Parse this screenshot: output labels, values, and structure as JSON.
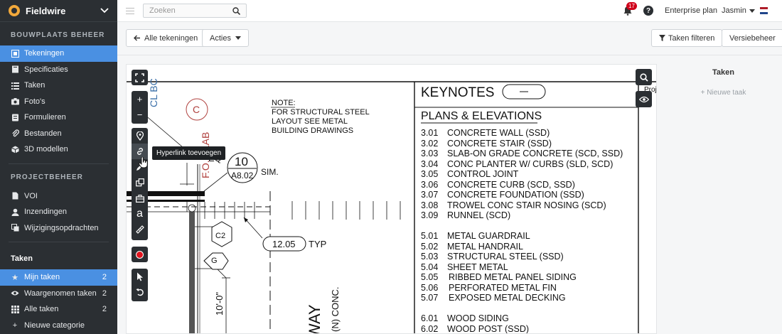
{
  "app": {
    "name": "Fieldwire"
  },
  "sidebar": {
    "section_site": "BOUWPLAATS BEHEER",
    "site_items": [
      {
        "label": "Tekeningen",
        "icon": "drawing-icon"
      },
      {
        "label": "Specificaties",
        "icon": "book-icon"
      },
      {
        "label": "Taken",
        "icon": "list-icon"
      },
      {
        "label": "Foto's",
        "icon": "camera-icon"
      },
      {
        "label": "Formulieren",
        "icon": "form-icon"
      },
      {
        "label": "Bestanden",
        "icon": "paperclip-icon"
      },
      {
        "label": "3D modellen",
        "icon": "cube-icon"
      }
    ],
    "section_project": "PROJECTBEHEER",
    "project_items": [
      {
        "label": "VOI",
        "icon": "document-icon"
      },
      {
        "label": "Inzendingen",
        "icon": "user-icon"
      },
      {
        "label": "Wijzigingsopdrachten",
        "icon": "change-order-icon"
      }
    ],
    "section_tasks": "Taken",
    "task_items": [
      {
        "label": "Mijn taken",
        "count": "2",
        "icon": "star-icon"
      },
      {
        "label": "Waargenomen taken",
        "count": "2",
        "icon": "eye-icon"
      },
      {
        "label": "Alle taken",
        "count": "2",
        "icon": "grid-icon"
      },
      {
        "label": "Nieuwe categorie",
        "count": "",
        "icon": "plus-icon"
      }
    ]
  },
  "topbar": {
    "search_placeholder": "Zoeken",
    "notification_count": "17",
    "plan": "Enterprise plan",
    "user": "Jasmin"
  },
  "toolbar": {
    "all_drawings": "Alle tekeningen",
    "actions": "Acties",
    "filter_tasks": "Taken filteren",
    "version_management": "Versiebeheer"
  },
  "drawing": {
    "tooltip": "Hyperlink toevoegen",
    "note_lines": [
      "NOTE:",
      "FOR STRUCTURAL STEEL",
      "LAYOUT SEE METAL",
      "BUILDING DRAWINGS"
    ],
    "keynotes_title": "KEYNOTES",
    "plans_title": "PLANS & ELEVATIONS",
    "keynotes": [
      {
        "code": "3.01",
        "text": "CONCRETE WALL (SSD)"
      },
      {
        "code": "3.02",
        "text": "CONCRETE STAIR (SSD)"
      },
      {
        "code": "3.03",
        "text": "SLAB-ON GRADE CONCRETE (SCD, SSD)"
      },
      {
        "code": "3.04",
        "text": "CONC PLANTER W/ CURBS (SLD, SCD)"
      },
      {
        "code": "3.05",
        "text": "CONTROL JOINT"
      },
      {
        "code": "3.06",
        "text": "CONCRETE CURB (SCD, SSD)"
      },
      {
        "code": "3.07",
        "text": "CONCRETE FOUNDATION (SSD)"
      },
      {
        "code": "3.08",
        "text": "TROWEL CONC STAIR NOSING (SCD)"
      },
      {
        "code": "3.09",
        "text": "RUNNEL (SCD)"
      },
      {
        "code": "5.01",
        "text": "METAL GUARDRAIL"
      },
      {
        "code": "5.02",
        "text": "METAL HANDRAIL"
      },
      {
        "code": "5.03",
        "text": "STRUCTURAL STEEL (SSD)"
      },
      {
        "code": "5.04",
        "text": "SHEET METAL"
      },
      {
        "code": "5.05",
        "text": "RIBBED METAL PANEL SIDING"
      },
      {
        "code": "5.06",
        "text": "PERFORATED METAL FIN"
      },
      {
        "code": "5.07",
        "text": "EXPOSED METAL DECKING"
      },
      {
        "code": "6.01",
        "text": "WOOD SIDING"
      },
      {
        "code": "6.02",
        "text": "WOOD POST (SSD)"
      }
    ],
    "labels": {
      "cl": "CL BC",
      "fo": "F.O. SLAB",
      "c": "C",
      "detail_num": "10",
      "detail_sheet": "A8.02",
      "sim": "SIM.",
      "eq": "EQ",
      "c2": "C2",
      "g": "G",
      "dim": "12.05",
      "typ": "TYP",
      "height": "10'-0\"",
      "conc": "(N) CONC.",
      "way": "WAY",
      "proj": "Proj"
    }
  },
  "right_panel": {
    "title": "Taken",
    "new_task": "+ Nieuwe taak"
  },
  "colors": {
    "sidebar": "#2b2f33",
    "active": "#4a90e2",
    "badge": "#d0021b",
    "blueprint_blue": "#3a6fa8",
    "blueprint_red": "#b0413e"
  }
}
